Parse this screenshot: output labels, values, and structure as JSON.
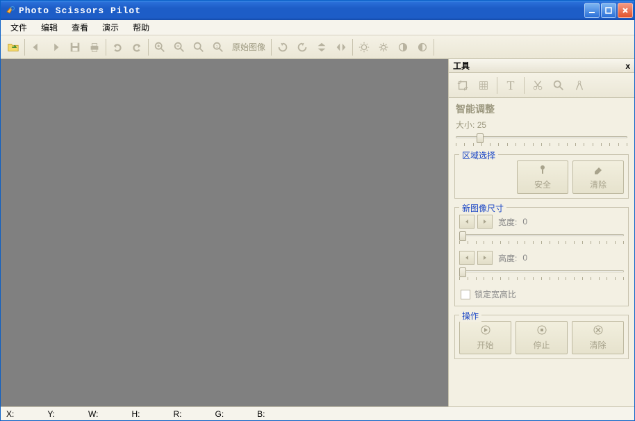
{
  "window": {
    "title": "Photo Scissors Pilot"
  },
  "menu": {
    "file": "文件",
    "edit": "编辑",
    "view": "查看",
    "demo": "演示",
    "help": "帮助"
  },
  "toolbar": {
    "original_label": "原始图像"
  },
  "sidepanel": {
    "title": "工具",
    "close": "x",
    "smart_adjust_title": "智能调整",
    "size_label": "大小:",
    "size_value": "25",
    "region_select": {
      "legend": "区域选择",
      "safe": "安全",
      "clear": "清除"
    },
    "new_size": {
      "legend": "新图像尺寸",
      "width_label": "宽度:",
      "width_value": "0",
      "height_label": "高度:",
      "height_value": "0",
      "lock_aspect": "锁定宽高比"
    },
    "actions": {
      "legend": "操作",
      "start": "开始",
      "stop": "停止",
      "clear": "清除"
    }
  },
  "status": {
    "x": "X:",
    "y": "Y:",
    "w": "W:",
    "h": "H:",
    "r": "R:",
    "g": "G:",
    "b": "B:"
  }
}
